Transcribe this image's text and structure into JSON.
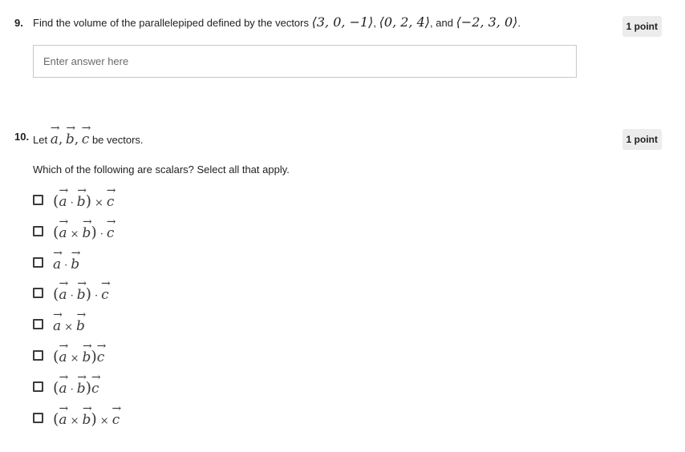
{
  "q9": {
    "number": "9.",
    "prefix": "Find the volume of the parallelepiped defined by the vectors",
    "v1": "⟨3, 0, −1⟩",
    "v2": "⟨0, 2, 4⟩",
    "and": "and",
    "v3": "⟨−2, 3, 0⟩",
    "end": ".",
    "points": "1 point",
    "input_value": "",
    "input_placeholder": "Enter answer here"
  },
  "q10": {
    "number": "10.",
    "let": "Let",
    "a": "a",
    "b": "b",
    "c": "c",
    "comma": ",",
    "be_vectors": "be vectors.",
    "points": "1 point",
    "instruction": "Which of the following are scalars? Select all that apply.",
    "options": [
      {
        "tokens": [
          "(",
          "a",
          "·",
          "b",
          ")",
          "×",
          "c"
        ],
        "checked": false
      },
      {
        "tokens": [
          "(",
          "a",
          "×",
          "b",
          ")",
          "·",
          "c"
        ],
        "checked": false
      },
      {
        "tokens": [
          "a",
          "·",
          "b"
        ],
        "checked": false
      },
      {
        "tokens": [
          "(",
          "a",
          "·",
          "b",
          ")",
          "·",
          "c"
        ],
        "checked": false
      },
      {
        "tokens": [
          "a",
          "×",
          "b"
        ],
        "checked": false
      },
      {
        "tokens": [
          "(",
          "a",
          "×",
          "b",
          ")",
          "c"
        ],
        "checked": false
      },
      {
        "tokens": [
          "(",
          "a",
          "·",
          "b",
          ")",
          "c"
        ],
        "checked": false
      },
      {
        "tokens": [
          "(",
          "a",
          "×",
          "b",
          ")",
          "×",
          "c"
        ],
        "checked": false
      }
    ]
  }
}
